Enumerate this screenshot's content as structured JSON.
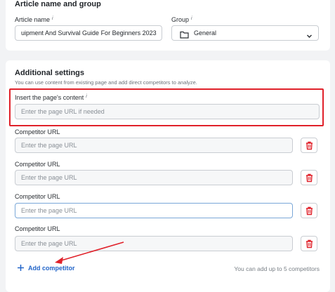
{
  "article_group": {
    "title": "Article name and group",
    "article_name_label": "Article name",
    "article_name_value": "uipment And Survival Guide For Beginners  2023",
    "group_label": "Group",
    "group_value": "General",
    "info_glyph": "i"
  },
  "additional": {
    "title": "Additional settings",
    "subtitle": "You can use content from existing page and add direct competitors to analyze.",
    "page_content_label": "Insert the page's content",
    "page_content_placeholder": "Enter the page URL if needed",
    "competitors": [
      {
        "label": "Competitor URL",
        "placeholder": "Enter the page URL"
      },
      {
        "label": "Competitor URL",
        "placeholder": "Enter the page URL"
      },
      {
        "label": "Competitor URL",
        "placeholder": "Enter the page URL"
      },
      {
        "label": "Competitor URL",
        "placeholder": "Enter the page URL"
      }
    ],
    "add_competitor_label": "Add competitor",
    "limit_hint": "You can add up to 5 competitors"
  },
  "colors": {
    "accent_blue": "#2466c9",
    "delete_red": "#e0212a",
    "highlight_red": "#e0212a"
  },
  "icons": {
    "folder": "folder-icon",
    "chevron": "chevron-down-icon",
    "trash": "trash-icon",
    "plus": "plus-icon"
  }
}
